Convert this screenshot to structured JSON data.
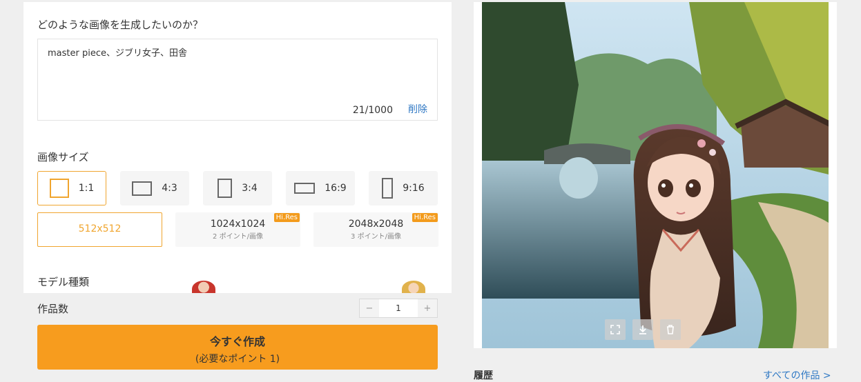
{
  "prompt": {
    "label": "どのような画像を生成したいのか？",
    "value": "master piece、ジブリ女子、田舎",
    "char_count": "21/1000",
    "clear_label": "削除"
  },
  "image_size": {
    "label": "画像サイズ",
    "ratios": [
      {
        "label": "1:1",
        "selected": true
      },
      {
        "label": "4:3",
        "selected": false
      },
      {
        "label": "3:4",
        "selected": false
      },
      {
        "label": "16:9",
        "selected": false
      },
      {
        "label": "9:16",
        "selected": false
      }
    ],
    "resolutions": [
      {
        "label": "512x512",
        "selected": true
      },
      {
        "label": "1024x1024",
        "cost": "2 ポイント/画像",
        "badge": "Hi.Res"
      },
      {
        "label": "2048x2048",
        "cost": "3 ポイント/画像",
        "badge": "Hi.Res"
      }
    ]
  },
  "model": {
    "label": "モデル種類"
  },
  "quantity": {
    "label": "作品数",
    "value": "1",
    "minus": "−",
    "plus": "+"
  },
  "generate": {
    "label": "今すぐ作成",
    "sub_label": "(必要なポイント 1)"
  },
  "history": {
    "title": "履歴",
    "all_works_link": "すべての作品 >"
  },
  "colors": {
    "accent": "#f79c1e",
    "selected_border": "#f0a52e",
    "link": "#2f78c4"
  },
  "icons": {
    "expand": "expand-icon",
    "download": "download-icon",
    "delete": "trash-icon"
  }
}
